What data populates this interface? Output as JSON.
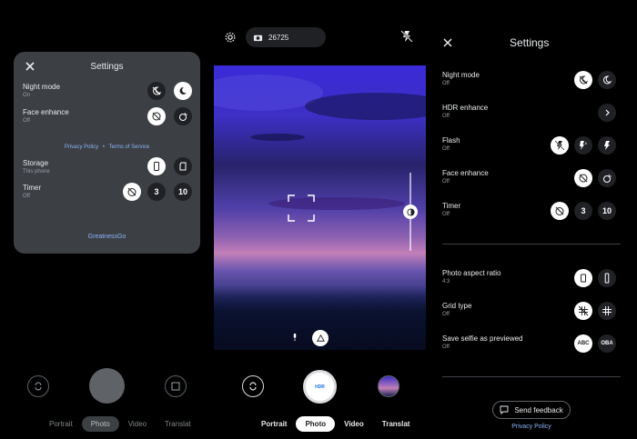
{
  "left_panel": {
    "title": "Settings",
    "night_mode": {
      "label": "Night mode",
      "value": "On"
    },
    "face_enhance": {
      "label": "Face enhance",
      "value": "Off"
    },
    "privacy_link": "Privacy Policy",
    "separator": "•",
    "tos_link": "Terms of Service",
    "storage": {
      "label": "Storage",
      "value": "This phone"
    },
    "timer": {
      "label": "Timer",
      "value": "Off",
      "opt3": "3",
      "opt10": "10"
    },
    "brand": "GreatnessGo"
  },
  "top_bar": {
    "photo_count": "26725"
  },
  "modes_left": [
    "Portrait",
    "Photo",
    "Video",
    "Translat"
  ],
  "modes_center": [
    "Portrait",
    "Photo",
    "Video",
    "Translat"
  ],
  "shutter_label": "HDR",
  "right_panel": {
    "title": "Settings",
    "night_mode": {
      "label": "Night mode",
      "value": "Off"
    },
    "hdr": {
      "label": "HDR enhance",
      "value": "Off"
    },
    "flash": {
      "label": "Flash",
      "value": "Off",
      "auto_glyph": "A"
    },
    "face_enhance": {
      "label": "Face enhance",
      "value": "Off"
    },
    "timer": {
      "label": "Timer",
      "value": "Off",
      "opt3": "3",
      "opt10": "10"
    },
    "aspect": {
      "label": "Photo aspect ratio",
      "value": "4:3"
    },
    "grid": {
      "label": "Grid type",
      "value": "Off"
    },
    "selfie": {
      "label": "Save selfie as previewed",
      "value": "Off",
      "opt1": "ABC",
      "opt2": "OBA"
    },
    "feedback": "Send feedback",
    "privacy": "Privacy Policy"
  },
  "colors": {
    "accent": "#8ab4f8",
    "panel": "#3c3f44"
  }
}
